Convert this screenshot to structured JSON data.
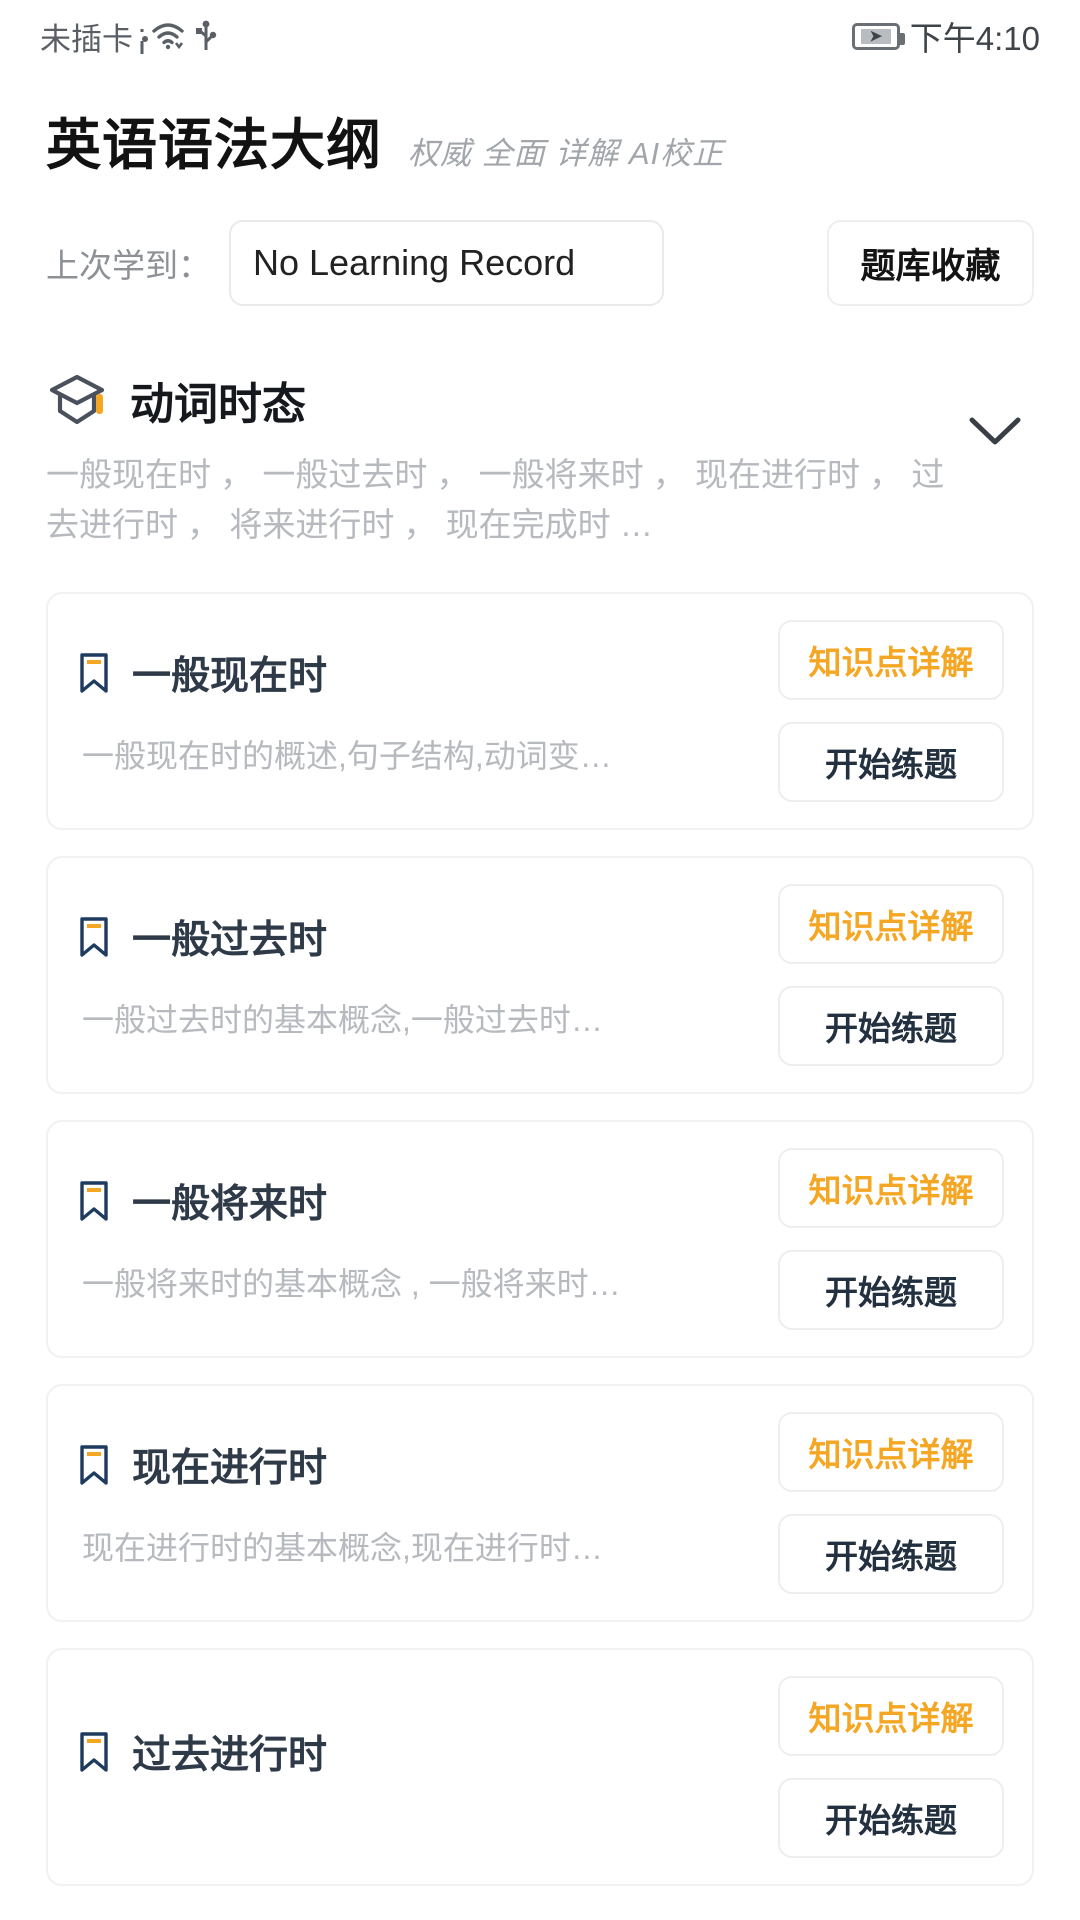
{
  "status_bar": {
    "carrier": "未插卡",
    "sim_icon": "sim-card-alert-icon",
    "wifi_icon": "wifi-icon",
    "usb_icon": "usb-icon",
    "battery_icon": "battery-charging-icon",
    "time": "下午4:10"
  },
  "header": {
    "title": "英语语法大纲",
    "subtitle": "权威 全面 详解 AI校正",
    "record_label": "上次学到：",
    "record_value": "No Learning Record",
    "favorites_button": "题库收藏"
  },
  "section": {
    "icon": "graduation-cap-icon",
    "title": "动词时态",
    "description": "一般现在时 ， 一般过去时 ， 一般将来时 ， 现在进行时 ， 过去进行时 ， 将来进行时 ， 现在完成时 …",
    "collapse_icon": "chevron-down-icon"
  },
  "buttons": {
    "detail_label": "知识点详解",
    "practice_label": "开始练题"
  },
  "colors": {
    "accent_orange": "#F5A623",
    "title_navy": "#2E3A48",
    "muted_gray": "#B6B9BD",
    "border_gray": "#F0F1F2"
  },
  "cards": [
    {
      "icon": "bookmark-icon",
      "title": "一般现在时",
      "description": "一般现在时的概述,句子结构,动词变…"
    },
    {
      "icon": "bookmark-icon",
      "title": "一般过去时",
      "description": "一般过去时的基本概念,一般过去时…"
    },
    {
      "icon": "bookmark-icon",
      "title": "一般将来时",
      "description": "一般将来时的基本概念 , 一般将来时…"
    },
    {
      "icon": "bookmark-icon",
      "title": "现在进行时",
      "description": "现在进行时的基本概念,现在进行时…"
    },
    {
      "icon": "bookmark-icon",
      "title": "过去进行时",
      "description": ""
    }
  ]
}
